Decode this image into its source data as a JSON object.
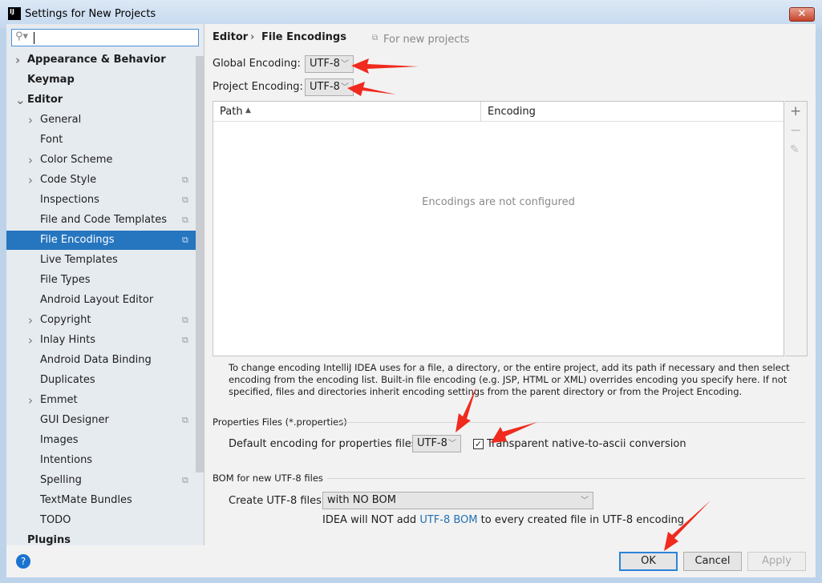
{
  "window": {
    "title": "Settings for New Projects",
    "app_icon": "IJ",
    "close": "✕"
  },
  "search": {
    "placeholder": "",
    "value": ""
  },
  "sidebar": {
    "items": [
      {
        "label": "Appearance & Behavior",
        "bold": true,
        "level": 0,
        "expand": "collapsed"
      },
      {
        "label": "Keymap",
        "bold": true,
        "level": 0
      },
      {
        "label": "Editor",
        "bold": true,
        "level": 0,
        "expand": "expanded"
      },
      {
        "label": "General",
        "level": 1,
        "expand": "collapsed"
      },
      {
        "label": "Font",
        "level": 1
      },
      {
        "label": "Color Scheme",
        "level": 1,
        "expand": "collapsed"
      },
      {
        "label": "Code Style",
        "level": 1,
        "expand": "collapsed",
        "copy": true
      },
      {
        "label": "Inspections",
        "level": 1,
        "copy": true
      },
      {
        "label": "File and Code Templates",
        "level": 1,
        "copy": true
      },
      {
        "label": "File Encodings",
        "level": 1,
        "copy": true,
        "selected": true
      },
      {
        "label": "Live Templates",
        "level": 1
      },
      {
        "label": "File Types",
        "level": 1
      },
      {
        "label": "Android Layout Editor",
        "level": 1
      },
      {
        "label": "Copyright",
        "level": 1,
        "expand": "collapsed",
        "copy": true
      },
      {
        "label": "Inlay Hints",
        "level": 1,
        "expand": "collapsed",
        "copy": true
      },
      {
        "label": "Android Data Binding",
        "level": 1
      },
      {
        "label": "Duplicates",
        "level": 1
      },
      {
        "label": "Emmet",
        "level": 1,
        "expand": "collapsed"
      },
      {
        "label": "GUI Designer",
        "level": 1,
        "copy": true
      },
      {
        "label": "Images",
        "level": 1
      },
      {
        "label": "Intentions",
        "level": 1
      },
      {
        "label": "Spelling",
        "level": 1,
        "copy": true
      },
      {
        "label": "TextMate Bundles",
        "level": 1
      },
      {
        "label": "TODO",
        "level": 1
      },
      {
        "label": "Plugins",
        "bold": true,
        "level": 0
      }
    ]
  },
  "main": {
    "breadcrumb": {
      "parent": "Editor",
      "sep": "›",
      "current": "File Encodings"
    },
    "scope_note": "For new projects",
    "global_label": "Global Encoding:",
    "global_value": "UTF-8",
    "project_label": "Project Encoding:",
    "project_value": "UTF-8",
    "table": {
      "col_path": "Path",
      "sort": "▲",
      "col_encoding": "Encoding",
      "empty": "Encodings are not configured"
    },
    "help": "To change encoding IntelliJ IDEA uses for a file, a directory, or the entire project, add its path if necessary and then select encoding from the encoding list. Built-in file encoding (e.g. JSP, HTML or XML) overrides encoding you specify here. If not specified, files and directories inherit encoding settings from the parent directory or from the Project Encoding.",
    "properties": {
      "title": "Properties Files (*.properties)",
      "label": "Default encoding for properties files:",
      "value": "UTF-8",
      "checkbox_label": "Transparent native-to-ascii conversion",
      "checked": true
    },
    "bom": {
      "title": "BOM for new UTF-8 files",
      "label": "Create UTF-8 files:",
      "value": "with NO BOM",
      "note_pre": "IDEA will NOT add ",
      "note_link": "UTF-8 BOM",
      "note_post": " to every created file in UTF-8 encoding"
    }
  },
  "buttons": {
    "ok": "OK",
    "cancel": "Cancel",
    "apply": "Apply",
    "help": "?"
  },
  "colors": {
    "selection": "#2675bf",
    "link": "#2470b3",
    "annotation_arrows": "#f02a1e"
  }
}
